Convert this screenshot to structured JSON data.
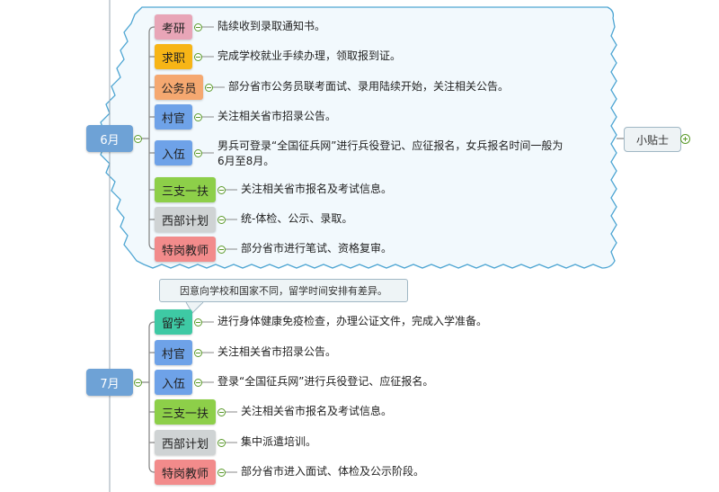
{
  "colors": {
    "pink": "#e8a5b7",
    "orange": "#f7b516",
    "salmon": "#f5a870",
    "blue": "#6ea2e8",
    "green": "#8dcf49",
    "gray": "#cfd3d4",
    "red": "#f28b8b",
    "teal": "#3ec9a4",
    "month": "#6ea2d6",
    "cloud_border": "#4fa6d3",
    "cloud_fill": "#f2f9fd"
  },
  "june": {
    "label": "6月",
    "tip": "小贴士",
    "items": [
      {
        "cat": "考研",
        "desc": "陆续收到录取通知书。",
        "color": "pink"
      },
      {
        "cat": "求职",
        "desc": "完成学校就业手续办理，领取报到证。",
        "color": "orange"
      },
      {
        "cat": "公务员",
        "desc": "部分省市公务员联考面试、录用陆续开始，关注相关公告。",
        "color": "salmon"
      },
      {
        "cat": "村官",
        "desc": "关注相关省市招录公告。",
        "color": "blue"
      },
      {
        "cat": "入伍",
        "desc": "男兵可登录“全国征兵网”进行兵役登记、应征报名，女兵报名时间一般为",
        "desc2": "6月至8月。",
        "color": "blue"
      },
      {
        "cat": "三支一扶",
        "desc": "关注相关省市报名及考试信息。",
        "color": "green"
      },
      {
        "cat": "西部计划",
        "desc": "统-体检、公示、录取。",
        "color": "gray"
      },
      {
        "cat": "特岗教师",
        "desc": "部分省市进行笔试、资格复审。",
        "color": "red"
      }
    ]
  },
  "july": {
    "label": "7月",
    "callout": "因意向学校和国家不同，留学时间安排有差异。",
    "items": [
      {
        "cat": "留学",
        "desc": "进行身体健康免疫检查，办理公证文件，完成入学准备。",
        "color": "teal"
      },
      {
        "cat": "村官",
        "desc": "关注相关省市招录公告。",
        "color": "blue"
      },
      {
        "cat": "入伍",
        "desc": "登录“全国征兵网”进行兵役登记、应征报名。",
        "color": "blue"
      },
      {
        "cat": "三支一扶",
        "desc": "关注相关省市报名及考试信息。",
        "color": "green"
      },
      {
        "cat": "西部计划",
        "desc": "集中派遣培训。",
        "color": "gray"
      },
      {
        "cat": "特岗教师",
        "desc": "部分省市进入面试、体检及公示阶段。",
        "color": "red"
      }
    ]
  }
}
